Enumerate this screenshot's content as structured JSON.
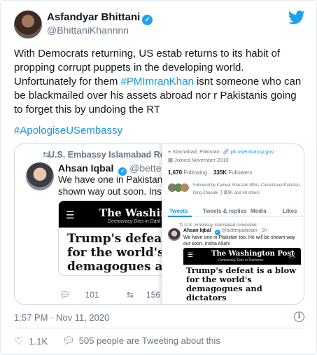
{
  "colors": {
    "accent": "#1da1f2",
    "link": "#1b95e0",
    "muted": "#657786"
  },
  "author": {
    "name": "Asfandyar Bhittani",
    "handle": "@BhittaniKhannnn",
    "verified_icon": "✓"
  },
  "tweet": {
    "text_before": "With Democrats returning, US estab returns to its habit of propping corrupt puppets in the developing world. Unfortunately for them ",
    "hashtag1": "#PMImranKhan",
    "text_after": " isnt someone who can be blackmailed over his assets abroad nor r Pakistanis going to forget this by undoing the RT",
    "hashtag2": "#ApologiseUSembassy"
  },
  "media_left": {
    "retweet_label": "U.S. Embassy Islamabad Ret",
    "name": "Ahsan Iqbal",
    "handle": "@betterpa",
    "text_line1": "We have one in Pakistan to",
    "text_line2": "shown way out soon. Insha",
    "masthead": "The Washington",
    "motto": "Democracy Dies in Dark",
    "headline": "Trump's defeat i for the world's demagogues anc dictators",
    "reply_count": "101",
    "retweet_count": "156",
    "like_count": "84"
  },
  "media_right": {
    "location": "Islamabad, Pakistan",
    "website": "pk.usembassy.gov",
    "joined": "Joined November 2010",
    "following_count": "1,670",
    "following_label": "Following",
    "followers_count": "335K",
    "followers_label": "Followers",
    "followed_by_line1": "Followed by Kanwal Shauzab MNA, CleanGreenPakistan,",
    "followed_by_line2": "Ding Zhaoule 丁肇泉, and 48 others",
    "tabs": [
      "Tweets",
      "Tweets & replies",
      "Media",
      "Likes"
    ],
    "retweeted_label": "U.S. Embassy Islamabad retweeted",
    "name": "Ahsan Iqbal",
    "handle": "@betterpakistan · 1h",
    "text": "We have one in Pakistan too. He will be shown way out soon. Insha Allah!",
    "masthead": "The Washington Post",
    "motto": "Democracy Dies in Darkness",
    "headline": "Trump's defeat is a blow for the world's demagogues and dictators"
  },
  "meta": {
    "timestamp": "1:57 PM · Nov 11, 2020",
    "likes": "1.1K",
    "tweeting_about": "505 people are Tweeting about this"
  }
}
